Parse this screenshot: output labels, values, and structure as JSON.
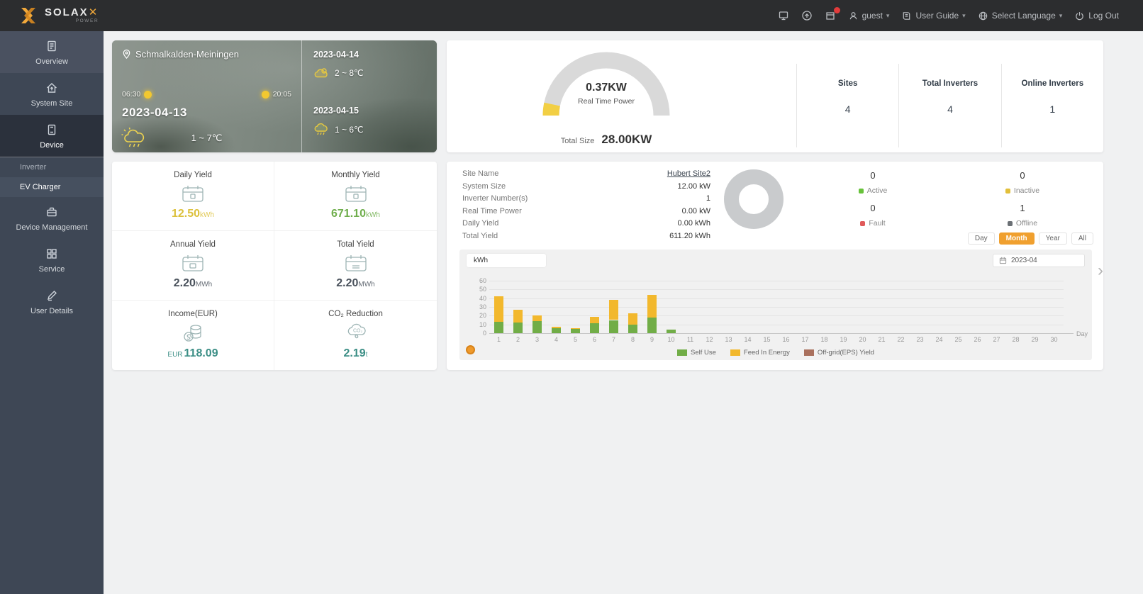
{
  "topbar": {
    "logo": "SOLAX",
    "logo_sub": "POWER",
    "badge_color": "#e23b3b",
    "username": "guest",
    "user_guide": "User Guide",
    "language": "Select Language",
    "logout": "Log Out"
  },
  "sidebar": {
    "items": [
      "Overview",
      "System Site",
      "Device",
      "Device Management",
      "Service",
      "User Details"
    ],
    "device_submenu": [
      "Inverter",
      "EV Charger"
    ]
  },
  "weather": {
    "location": "Schmalkalden-Meiningen",
    "sunrise": "06:30",
    "sunset": "20:05",
    "today_date": "2023-04-13",
    "today_temp": "1 ~ 7℃",
    "forecast": [
      {
        "date": "2023-04-14",
        "temp": "2 ~ 8℃"
      },
      {
        "date": "2023-04-15",
        "temp": "1 ~ 6℃"
      }
    ]
  },
  "power_card": {
    "gauge_value": "0.37KW",
    "gauge_label": "Real Time Power",
    "gauge_track_color": "#d9d9d9",
    "gauge_accent_color": "#f2cf44",
    "total_size_label": "Total Size",
    "total_size_value": "28.00KW",
    "stats": [
      {
        "label": "Sites",
        "value": "4"
      },
      {
        "label": "Total Inverters",
        "value": "4"
      },
      {
        "label": "Online Inverters",
        "value": "1"
      }
    ]
  },
  "yield_card": {
    "cells": [
      {
        "label": "Daily Yield",
        "prefix": "",
        "value": "12.50",
        "unit": "kWh",
        "color": "#dcc13c"
      },
      {
        "label": "Monthly Yield",
        "prefix": "",
        "value": "671.10",
        "unit": "kWh",
        "color": "#6fae4c"
      },
      {
        "label": "Annual Yield",
        "prefix": "",
        "value": "2.20",
        "unit": "MWh",
        "color": "#4a525c"
      },
      {
        "label": "Total Yield",
        "prefix": "",
        "value": "2.20",
        "unit": "MWh",
        "color": "#4a525c"
      },
      {
        "label": "Income(EUR)",
        "prefix": "EUR",
        "value": "118.09",
        "unit": "",
        "color": "#3b8e85"
      },
      {
        "label": "CO₂ Reduction",
        "prefix": "",
        "value": "2.19",
        "unit": "t",
        "color": "#3b8e85"
      }
    ]
  },
  "site_card": {
    "details": [
      {
        "label": "Site Name",
        "value": "Hubert Site2"
      },
      {
        "label": "System Size",
        "value": "12.00 kW"
      },
      {
        "label": "Inverter Number(s)",
        "value": "1"
      },
      {
        "label": "Real Time Power",
        "value": "0.00 kW"
      },
      {
        "label": "Daily Yield",
        "value": "0.00 kWh"
      },
      {
        "label": "Total Yield",
        "value": "611.20 kWh"
      }
    ],
    "donut_color": "#c9cbcd",
    "statuses": [
      {
        "value": "0",
        "label": "Active",
        "color": "#67c23a"
      },
      {
        "value": "0",
        "label": "Inactive",
        "color": "#e2bf3a"
      },
      {
        "value": "0",
        "label": "Fault",
        "color": "#e05a5a"
      },
      {
        "value": "1",
        "label": "Offline",
        "color": "#6b7075"
      }
    ],
    "period_tabs": [
      "Day",
      "Month",
      "Year",
      "All"
    ],
    "period_active": "Month",
    "period_active_color": "#f0a02f",
    "date_picker": "2023-04"
  },
  "chart_data": {
    "type": "bar",
    "stacked": true,
    "unit_tab_label": "kWh",
    "xlabel": "Day",
    "x": [
      1,
      2,
      3,
      4,
      5,
      6,
      7,
      8,
      9,
      10,
      11,
      12,
      13,
      14,
      15,
      16,
      17,
      18,
      19,
      20,
      21,
      22,
      23,
      24,
      25,
      26,
      27,
      28,
      29,
      30
    ],
    "ylim": [
      0,
      60
    ],
    "yticks": [
      0,
      10,
      20,
      30,
      40,
      50,
      60
    ],
    "grid": true,
    "legend_position": "bottom",
    "series": [
      {
        "name": "Self Use",
        "color": "#71ad47",
        "values": [
          13,
          12,
          14,
          6,
          5,
          11,
          15,
          10,
          18,
          4,
          0,
          0,
          0,
          0,
          0,
          0,
          0,
          0,
          0,
          0,
          0,
          0,
          0,
          0,
          0,
          0,
          0,
          0,
          0,
          0
        ]
      },
      {
        "name": "Feed In Energy",
        "color": "#f2b82d",
        "values": [
          29,
          15,
          6,
          1,
          1,
          8,
          23,
          13,
          26,
          0,
          0,
          0,
          0,
          0,
          0,
          0,
          0,
          0,
          0,
          0,
          0,
          0,
          0,
          0,
          0,
          0,
          0,
          0,
          0,
          0
        ]
      },
      {
        "name": "Off-grid(EPS) Yield",
        "color": "#a9705d",
        "values": [
          0,
          0,
          0,
          0,
          0,
          0,
          0,
          0,
          0,
          0,
          0,
          0,
          0,
          0,
          0,
          0,
          0,
          0,
          0,
          0,
          0,
          0,
          0,
          0,
          0,
          0,
          0,
          0,
          0,
          0
        ]
      }
    ]
  }
}
